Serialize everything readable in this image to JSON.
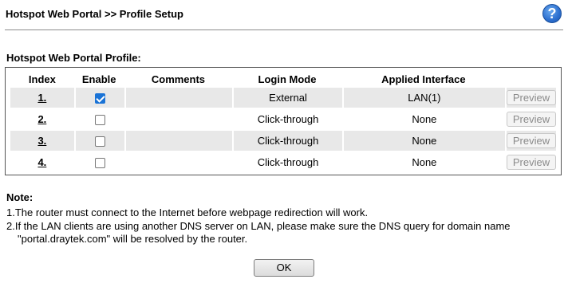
{
  "header": {
    "title": "Hotspot Web Portal >> Profile Setup",
    "help_symbol": "?"
  },
  "section": {
    "label": "Hotspot Web Portal Profile:"
  },
  "table": {
    "columns": [
      "Index",
      "Enable",
      "Comments",
      "Login Mode",
      "Applied Interface",
      ""
    ],
    "rows": [
      {
        "index": "1.",
        "enabled": true,
        "comments": "",
        "login_mode": "External",
        "applied_interface": "LAN(1)",
        "preview": "Preview"
      },
      {
        "index": "2.",
        "enabled": false,
        "comments": "",
        "login_mode": "Click-through",
        "applied_interface": "None",
        "preview": "Preview"
      },
      {
        "index": "3.",
        "enabled": false,
        "comments": "",
        "login_mode": "Click-through",
        "applied_interface": "None",
        "preview": "Preview"
      },
      {
        "index": "4.",
        "enabled": false,
        "comments": "",
        "login_mode": "Click-through",
        "applied_interface": "None",
        "preview": "Preview"
      }
    ]
  },
  "note": {
    "title": "Note:",
    "line1": "1.The router must connect to the Internet before webpage redirection will work.",
    "line2": "2.If the LAN clients are using another DNS server on LAN, please make sure the DNS query for domain name",
    "line2_cont": "\"portal.draytek.com\" will be resolved by the router."
  },
  "ok_label": "OK",
  "colors": {
    "row_shade": "#e8e8e8",
    "checkbox_checked": "#1a73d6",
    "help_icon": "#2c6fcf"
  }
}
